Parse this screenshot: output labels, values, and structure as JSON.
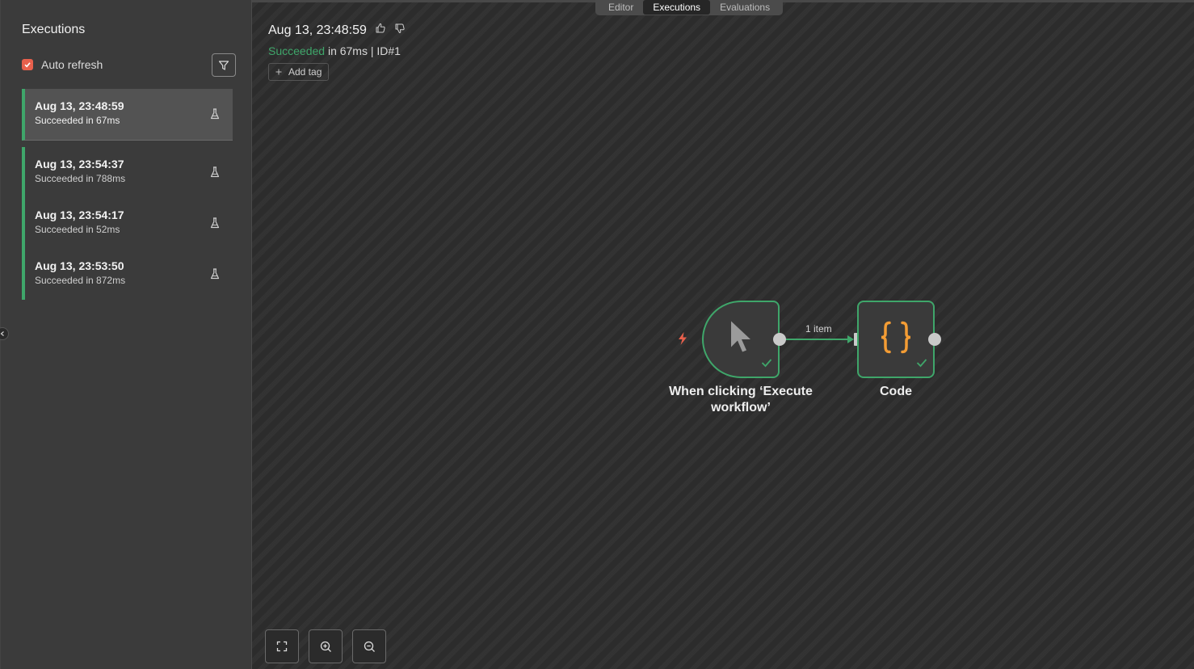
{
  "sidebar": {
    "title": "Executions",
    "auto_refresh_label": "Auto refresh",
    "auto_refresh_checked": true,
    "executions": [
      {
        "time": "Aug 13, 23:48:59",
        "status": "Succeeded in 67ms",
        "active": true
      },
      {
        "time": "Aug 13, 23:54:37",
        "status": "Succeeded in 788ms",
        "active": false
      },
      {
        "time": "Aug 13, 23:54:17",
        "status": "Succeeded in 52ms",
        "active": false
      },
      {
        "time": "Aug 13, 23:53:50",
        "status": "Succeeded in 872ms",
        "active": false
      }
    ]
  },
  "tabs": [
    {
      "label": "Editor",
      "active": false
    },
    {
      "label": "Executions",
      "active": true
    },
    {
      "label": "Evaluations",
      "active": false
    }
  ],
  "header": {
    "title": "Aug 13, 23:48:59",
    "status_word": "Succeeded",
    "status_rest": " in 67ms | ID#1",
    "add_tag_label": "Add tag"
  },
  "workflow": {
    "trigger_node_label": "When clicking ‘Execute workflow’",
    "code_node_label": "Code",
    "edge_label": "1 item"
  },
  "colors": {
    "success": "#3fa66a",
    "checkbox": "#e8604c",
    "code_icon": "#f39c34",
    "trigger_bolt": "#e8604c"
  }
}
